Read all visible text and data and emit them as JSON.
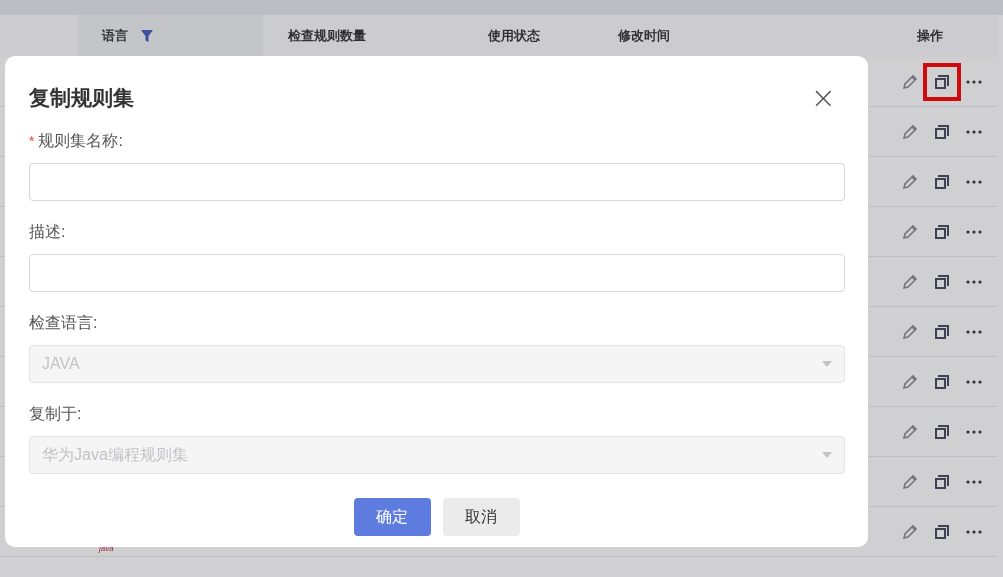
{
  "table": {
    "columns": [
      {
        "kind": "blank"
      },
      {
        "label": "语言",
        "kind": "filter",
        "selected": true
      },
      {
        "label": "检查规则数量",
        "kind": "plain"
      },
      {
        "label": "使用状态",
        "kind": "plain"
      },
      {
        "label": "修改时间",
        "kind": "plain"
      },
      {
        "label": "操作",
        "kind": "plain"
      }
    ],
    "rows": [
      {
        "highlighted": true
      },
      {},
      {},
      {},
      {},
      {},
      {},
      {},
      {},
      {
        "language": "java"
      }
    ]
  },
  "dialog": {
    "title": "复制规则集",
    "close": "×",
    "fields": [
      {
        "label": "规则集名称:",
        "marker": "*",
        "kind": "input"
      },
      {
        "label": "描述:",
        "kind": "input"
      },
      {
        "label": "检查语言:",
        "kind": "select",
        "value": "JAVA",
        "disabled": true
      },
      {
        "label": "复制于:",
        "kind": "select",
        "value": "华为Java编程规则集",
        "disabled": true
      }
    ],
    "buttons": [
      {
        "label": "确定",
        "kind": "primary"
      },
      {
        "label": "取消",
        "kind": "secondary"
      }
    ]
  }
}
